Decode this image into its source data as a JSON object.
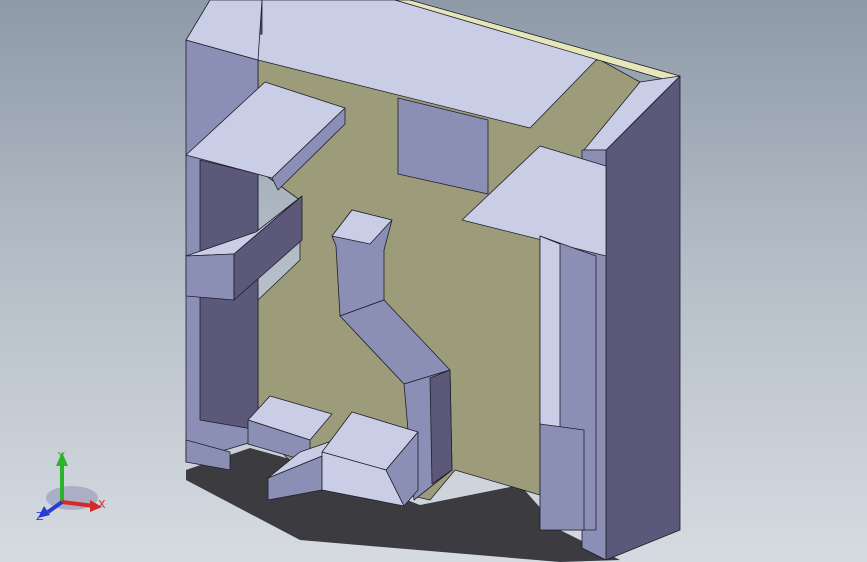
{
  "viewport": {
    "background_top": "#8e9aa8",
    "background_bottom": "#d6dbe1"
  },
  "model": {
    "colors": {
      "face_light": "#c9cde6",
      "face_mid": "#8c8fb5",
      "face_dark": "#5b5879",
      "back_wall": "#9d9c7a",
      "shadow": "#3b3b40",
      "edge": "#1e1e2a"
    }
  },
  "triad": {
    "x_label": "X",
    "y_label": "Y",
    "z_label": "Z",
    "x_color": "#d42a2a",
    "y_color": "#2bb32b",
    "z_color": "#2a3ad4"
  }
}
